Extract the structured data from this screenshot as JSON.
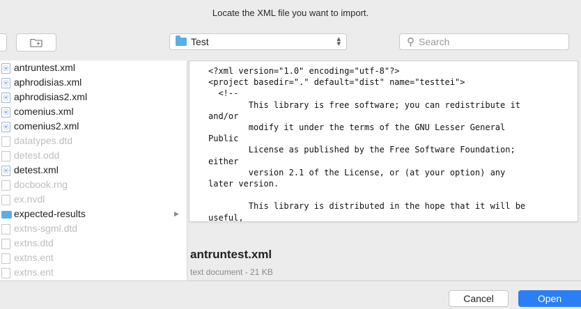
{
  "dialog": {
    "title": "Locate the XML file you want to import."
  },
  "toolbar": {
    "location": "Test",
    "search_placeholder": "Search"
  },
  "files": [
    {
      "name": "antruntest.xml",
      "kind": "xml",
      "enabled": true
    },
    {
      "name": "aphrodisias.xml",
      "kind": "xml",
      "enabled": true
    },
    {
      "name": "aphrodisias2.xml",
      "kind": "xml",
      "enabled": true
    },
    {
      "name": "comenius.xml",
      "kind": "xml",
      "enabled": true
    },
    {
      "name": "comenius2.xml",
      "kind": "xml",
      "enabled": true
    },
    {
      "name": "datatypes.dtd",
      "kind": "file",
      "enabled": false
    },
    {
      "name": "detest.odd",
      "kind": "file",
      "enabled": false
    },
    {
      "name": "detest.xml",
      "kind": "xml",
      "enabled": true
    },
    {
      "name": "docbook.rng",
      "kind": "file",
      "enabled": false
    },
    {
      "name": "ex.nvdl",
      "kind": "file",
      "enabled": false
    },
    {
      "name": "expected-results",
      "kind": "folder",
      "enabled": true
    },
    {
      "name": "extns-sgml.dtd",
      "kind": "file",
      "enabled": false
    },
    {
      "name": "extns.dtd",
      "kind": "file",
      "enabled": false
    },
    {
      "name": "extns.ent",
      "kind": "file",
      "enabled": false
    },
    {
      "name": "extns.ent",
      "kind": "file",
      "enabled": false
    }
  ],
  "preview": {
    "text": "<?xml version=\"1.0\" encoding=\"utf-8\"?>\n<project basedir=\".\" default=\"dist\" name=\"testtei\">\n  <!--\n        This library is free software; you can redistribute it\nand/or\n        modify it under the terms of the GNU Lesser General\nPublic\n        License as published by the Free Software Foundation;\neither\n        version 2.1 of the License, or (at your option) any\nlater version.\n\n        This library is distributed in the hope that it will be\nuseful,\n        but WITHOUT ANY WARRANTY; without even the implied\nwarranty of",
    "file_name": "antruntest.xml",
    "file_meta": "text document - 21 KB"
  },
  "buttons": {
    "cancel": "Cancel",
    "open": "Open"
  },
  "colors": {
    "accent": "#2a7ff6",
    "folder": "#5aaee6"
  }
}
